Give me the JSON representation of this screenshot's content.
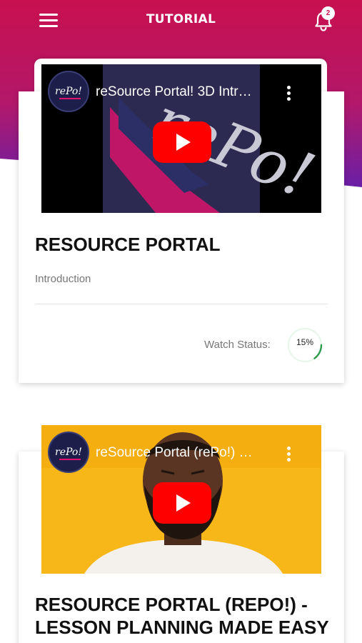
{
  "header": {
    "title": "TUTORIAL",
    "notification_count": "2",
    "gradient_top": "#c8104f",
    "gradient_bottom": "#6a1fa6"
  },
  "tutorials": [
    {
      "video": {
        "channel_logo_text": "rePo!",
        "title": "reSource Portal! 3D Intr…",
        "thumbnail": "dark-3d-logo"
      },
      "title": "RESOURCE PORTAL",
      "subtitle": "Introduction",
      "watch_status_label": "Watch Status:",
      "watch_progress": 0.15,
      "watch_progress_text": "15%"
    },
    {
      "video": {
        "channel_logo_text": "rePo!",
        "title": "reSource Portal (rePo!) …",
        "thumbnail": "man-on-yellow"
      },
      "title_line1": "RESOURCE PORTAL (REPO!) -",
      "title_line2": "LESSON PLANNING MADE EASY"
    }
  ],
  "colors": {
    "progress_track": "#e8f5e9",
    "progress_fill": "#2e9b4e",
    "youtube_red": "#ff0000"
  }
}
